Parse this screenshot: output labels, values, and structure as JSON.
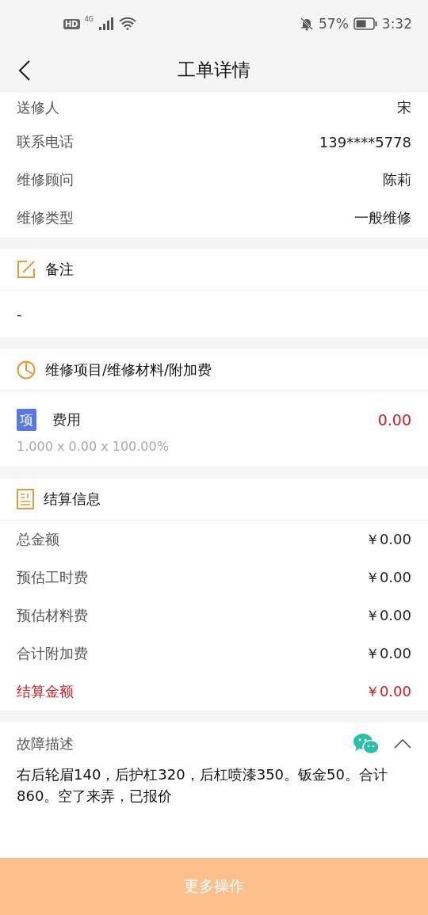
{
  "status_bar": {
    "network_badge": "HD",
    "network_type": "4G",
    "battery": "57%",
    "time": "3:32"
  },
  "header": {
    "title": "工单详情"
  },
  "info_rows": [
    {
      "label": "送修人",
      "value": "宋"
    },
    {
      "label": "联系电话",
      "value": "139****5778"
    },
    {
      "label": "维修顾问",
      "value": "陈莉"
    },
    {
      "label": "维修类型",
      "value": "一般维修"
    }
  ],
  "remarks": {
    "title": "备注",
    "text": "-"
  },
  "items_section": {
    "title": "维修项目/维修材料/附加费",
    "items": [
      {
        "badge": "项",
        "name": "费用",
        "amount": "0.00",
        "formula": "1.000 x 0.00 x 100.00%"
      }
    ]
  },
  "settlement": {
    "title": "结算信息",
    "rows": [
      {
        "label": "总金额",
        "value": "￥0.00",
        "kind": "normal"
      },
      {
        "label": "预估工时费",
        "value": "￥0.00",
        "kind": "normal"
      },
      {
        "label": "预估材料费",
        "value": "￥0.00",
        "kind": "normal"
      },
      {
        "label": "合计附加费",
        "value": "￥0.00",
        "kind": "normal"
      },
      {
        "label": "结算金额",
        "value": "￥0.00",
        "kind": "total"
      }
    ]
  },
  "fault": {
    "title": "故障描述",
    "expanded": true,
    "text": "右后轮眉140，后护杠320，后杠喷漆350。钣金50。合计860。空了来弄，已报价"
  },
  "action_button": {
    "label": "更多操作"
  }
}
